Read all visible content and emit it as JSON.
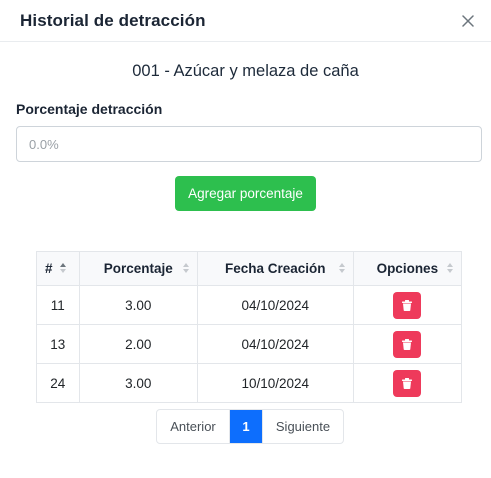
{
  "modal": {
    "title": "Historial de detracción",
    "close_icon": "close-icon"
  },
  "product": {
    "title": "001 - Azúcar y melaza de caña"
  },
  "form": {
    "label": "Porcentaje detracción",
    "input_value": "",
    "input_placeholder": "0.0%",
    "add_button_label": "Agregar porcentaje",
    "add_button_color": "#2dbf4e"
  },
  "table": {
    "columns": [
      "#",
      "Porcentaje",
      "Fecha Creación",
      "Opciones"
    ],
    "rows": [
      {
        "id": "11",
        "percent": "3.00",
        "date": "04/10/2024",
        "action_icon": "trash-icon"
      },
      {
        "id": "13",
        "percent": "2.00",
        "date": "04/10/2024",
        "action_icon": "trash-icon"
      },
      {
        "id": "24",
        "percent": "3.00",
        "date": "10/10/2024",
        "action_icon": "trash-icon"
      }
    ],
    "delete_color": "#ee3a5b"
  },
  "pagination": {
    "prev_label": "Anterior",
    "current_page": "1",
    "next_label": "Siguiente",
    "active_color": "#0d6efd"
  }
}
